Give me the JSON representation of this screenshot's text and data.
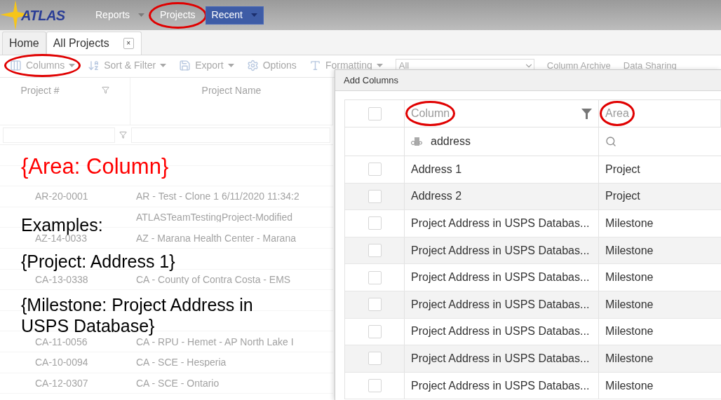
{
  "header": {
    "logo": "ATLAS",
    "menu": [
      {
        "label": "Reports",
        "dropdown": true,
        "circled": false,
        "selected": false
      },
      {
        "label": "Projects",
        "dropdown": false,
        "circled": true,
        "selected": false
      },
      {
        "label": "Recent",
        "dropdown": true,
        "circled": false,
        "selected": true
      }
    ]
  },
  "tabs": [
    {
      "label": "Home",
      "selected": false
    },
    {
      "label": "All Projects",
      "selected": true,
      "close": "×"
    }
  ],
  "toolbar": [
    {
      "kind": "button",
      "label": "Columns",
      "dropdown": true,
      "circled": true
    },
    {
      "kind": "button",
      "label": "Sort & Filter",
      "dropdown": true,
      "circled": false
    },
    {
      "kind": "button",
      "label": "Export",
      "dropdown": true,
      "circled": false
    },
    {
      "kind": "button",
      "label": "Options",
      "dropdown": false,
      "circled": false
    },
    {
      "kind": "button",
      "label": "Formatting",
      "dropdown": true,
      "circled": false
    },
    {
      "kind": "select",
      "label": "All"
    },
    {
      "kind": "link",
      "label": "Column Archive"
    },
    {
      "kind": "link",
      "label": "Data Sharing"
    }
  ],
  "grid": {
    "columns": [
      {
        "label": "Project #",
        "filter": true
      },
      {
        "label": "Project Name",
        "filter": false
      }
    ],
    "rows": [
      {},
      {},
      {
        "number": "AR-20-0001",
        "name": "AR - Test - Clone 1 6/11/2020 11:34:2"
      },
      {
        "name": "ATLASTeamTestingProject-Modified"
      },
      {
        "number": "AZ-14-0033",
        "name": "AZ - Marana Health Center - Marana"
      },
      {},
      {
        "number": "CA-13-0338",
        "name": "CA - County of Contra Costa - EMS"
      },
      {},
      {},
      {
        "number": "CA-11-0056",
        "name": "CA - RPU - Hemet - AP North Lake I"
      },
      {
        "number": "CA-10-0094",
        "name": "CA - SCE - Hesperia"
      },
      {
        "number": "CA-12-0307",
        "name": "CA - SCE - Ontario"
      }
    ]
  },
  "annotation": {
    "title": "{Area: Column}",
    "lines": [
      "Examples:",
      "{Project: Address 1}",
      "{Milestone: Project Address in USPS Database}"
    ]
  },
  "dialog": {
    "title": "Add Columns",
    "select_all": {
      "checked": false
    },
    "columns": [
      {
        "label": "Column",
        "circled": true,
        "filter": true
      },
      {
        "label": "Area",
        "circled": true,
        "filter": false
      }
    ],
    "search": {
      "value": "address"
    },
    "rows": [
      {
        "column": "Address 1",
        "area": "Project",
        "checked": false
      },
      {
        "column": "Address 2",
        "area": "Project",
        "checked": false
      },
      {
        "column": "Project Address in USPS Databas...",
        "area": "Milestone",
        "checked": false
      },
      {
        "column": "Project Address in USPS Databas...",
        "area": "Milestone",
        "checked": false
      },
      {
        "column": "Project Address in USPS Databas...",
        "area": "Milestone",
        "checked": false
      },
      {
        "column": "Project Address in USPS Databas...",
        "area": "Milestone",
        "checked": false
      },
      {
        "column": "Project Address in USPS Databas...",
        "area": "Milestone",
        "checked": false
      },
      {
        "column": "Project Address in USPS Databas...",
        "area": "Milestone",
        "checked": false
      },
      {
        "column": "Project Address in USPS Databas...",
        "area": "Milestone",
        "checked": false
      }
    ]
  }
}
